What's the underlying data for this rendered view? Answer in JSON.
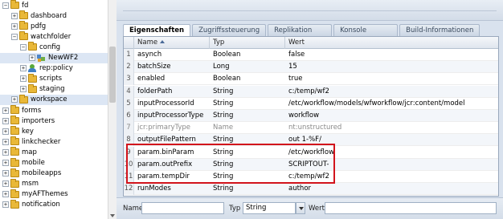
{
  "tree": {
    "items": [
      {
        "label": "fd",
        "indent": 0,
        "expander": "−",
        "icon": "folder"
      },
      {
        "label": "dashboard",
        "indent": 1,
        "expander": "+",
        "icon": "folder"
      },
      {
        "label": "pdfg",
        "indent": 1,
        "expander": "+",
        "icon": "folder"
      },
      {
        "label": "watchfolder",
        "indent": 1,
        "expander": "−",
        "icon": "folder"
      },
      {
        "label": "config",
        "indent": 2,
        "expander": "−",
        "icon": "folder"
      },
      {
        "label": "NewWF2",
        "indent": 3,
        "expander": "+",
        "icon": "node",
        "selected": true
      },
      {
        "label": "rep:policy",
        "indent": 2,
        "expander": "+",
        "icon": "policy"
      },
      {
        "label": "scripts",
        "indent": 2,
        "expander": "+",
        "icon": "folder"
      },
      {
        "label": "staging",
        "indent": 2,
        "expander": "+",
        "icon": "folder"
      },
      {
        "label": "workspace",
        "indent": 1,
        "expander": "+",
        "icon": "folder",
        "selected": true
      },
      {
        "label": "forms",
        "indent": 0,
        "expander": "+",
        "icon": "folder"
      },
      {
        "label": "importers",
        "indent": 0,
        "expander": "+",
        "icon": "folder"
      },
      {
        "label": "key",
        "indent": 0,
        "expander": "+",
        "icon": "folder"
      },
      {
        "label": "linkchecker",
        "indent": 0,
        "expander": "+",
        "icon": "folder"
      },
      {
        "label": "map",
        "indent": 0,
        "expander": "+",
        "icon": "folder"
      },
      {
        "label": "mobile",
        "indent": 0,
        "expander": "+",
        "icon": "folder"
      },
      {
        "label": "mobileapps",
        "indent": 0,
        "expander": "+",
        "icon": "folder"
      },
      {
        "label": "msm",
        "indent": 0,
        "expander": "+",
        "icon": "folder"
      },
      {
        "label": "myAFThemes",
        "indent": 0,
        "expander": "+",
        "icon": "folder"
      },
      {
        "label": "notification",
        "indent": 0,
        "expander": "+",
        "icon": "folder"
      }
    ]
  },
  "tabs": [
    {
      "label": "Eigenschaften",
      "active": true
    },
    {
      "label": "Zugriffssteuerung",
      "active": false
    },
    {
      "label": "Replikation",
      "active": false
    },
    {
      "label": "Konsole",
      "active": false
    },
    {
      "label": "Build-Informationen",
      "active": false
    }
  ],
  "grid": {
    "headers": {
      "num": "",
      "name": "Name",
      "type": "Typ",
      "value": "Wert"
    },
    "rows": [
      {
        "num": "1",
        "name": "asynch",
        "type": "Boolean",
        "value": "false"
      },
      {
        "num": "2",
        "name": "batchSize",
        "type": "Long",
        "value": "15"
      },
      {
        "num": "3",
        "name": "enabled",
        "type": "Boolean",
        "value": "true"
      },
      {
        "num": "4",
        "name": "folderPath",
        "type": "String",
        "value": "c:/temp/wf2"
      },
      {
        "num": "5",
        "name": "inputProcessorId",
        "type": "String",
        "value": "/etc/workflow/models/wfworkflow/jcr:content/model"
      },
      {
        "num": "6",
        "name": "inputProcessorType",
        "type": "String",
        "value": "workflow"
      },
      {
        "num": "7",
        "name": "jcr:primaryType",
        "type": "Name",
        "value": "nt:unstructured",
        "dim": true
      },
      {
        "num": "8",
        "name": "outputFilePattern",
        "type": "String",
        "value": "out 1-%F/"
      },
      {
        "num": "9",
        "name": "param.binParam",
        "type": "String",
        "value": "/etc/workflow"
      },
      {
        "num": "10",
        "name": "param.outPrefix",
        "type": "String",
        "value": "SCRIPTOUT-"
      },
      {
        "num": "11",
        "name": "param.tempDir",
        "type": "String",
        "value": "c:/temp/wf2"
      },
      {
        "num": "12",
        "name": "runModes",
        "type": "String",
        "value": "author"
      }
    ]
  },
  "form": {
    "name_label": "Name",
    "name_value": "",
    "type_label": "Typ",
    "type_value": "String",
    "value_label": "Wert",
    "value_value": ""
  },
  "colors": {
    "highlight": "#d2141c",
    "panel_bg": "#d9e2ee",
    "selection": "#dce6f4"
  }
}
